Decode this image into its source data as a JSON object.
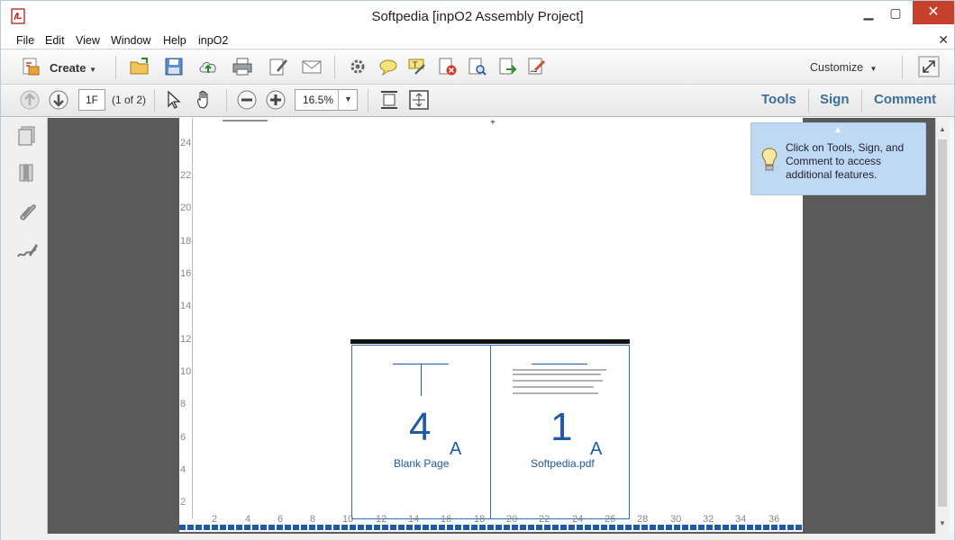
{
  "window": {
    "title": "Softpedia [inpO2 Assembly Project]",
    "minimize": "▁",
    "maximize": "▢",
    "close": "✕"
  },
  "menu": {
    "items": [
      "File",
      "Edit",
      "View",
      "Window",
      "Help",
      "inpO2"
    ],
    "close_doc": "✕"
  },
  "toolbar": {
    "create_label": "Create",
    "customize_label": "Customize"
  },
  "nav": {
    "page_value": "1F",
    "page_count": "(1 of 2)",
    "zoom_value": "16.5%"
  },
  "tabs": {
    "tools": "Tools",
    "sign": "Sign",
    "comment": "Comment"
  },
  "tooltip": {
    "text": "Click on Tools, Sign, and Comment to access additional features."
  },
  "document": {
    "left_panel": {
      "number": "4",
      "label": "Blank Page",
      "letter": "A"
    },
    "right_panel": {
      "number": "1",
      "label": "Softpedia.pdf",
      "letter": "A"
    },
    "ruler_v_labels": [
      "24",
      "22",
      "20",
      "18",
      "16",
      "14",
      "12",
      "10",
      "8",
      "6",
      "4",
      "2"
    ],
    "ruler_h_labels": [
      "2",
      "4",
      "6",
      "8",
      "10",
      "12",
      "14",
      "16",
      "18",
      "20",
      "22",
      "24",
      "26",
      "28",
      "30",
      "32",
      "34",
      "36"
    ]
  },
  "colors": {
    "accent": "#3d6e9e",
    "panel_blue": "#1f5aa6",
    "tooltip_bg": "#bfd9f3",
    "close_red": "#c7402c"
  }
}
